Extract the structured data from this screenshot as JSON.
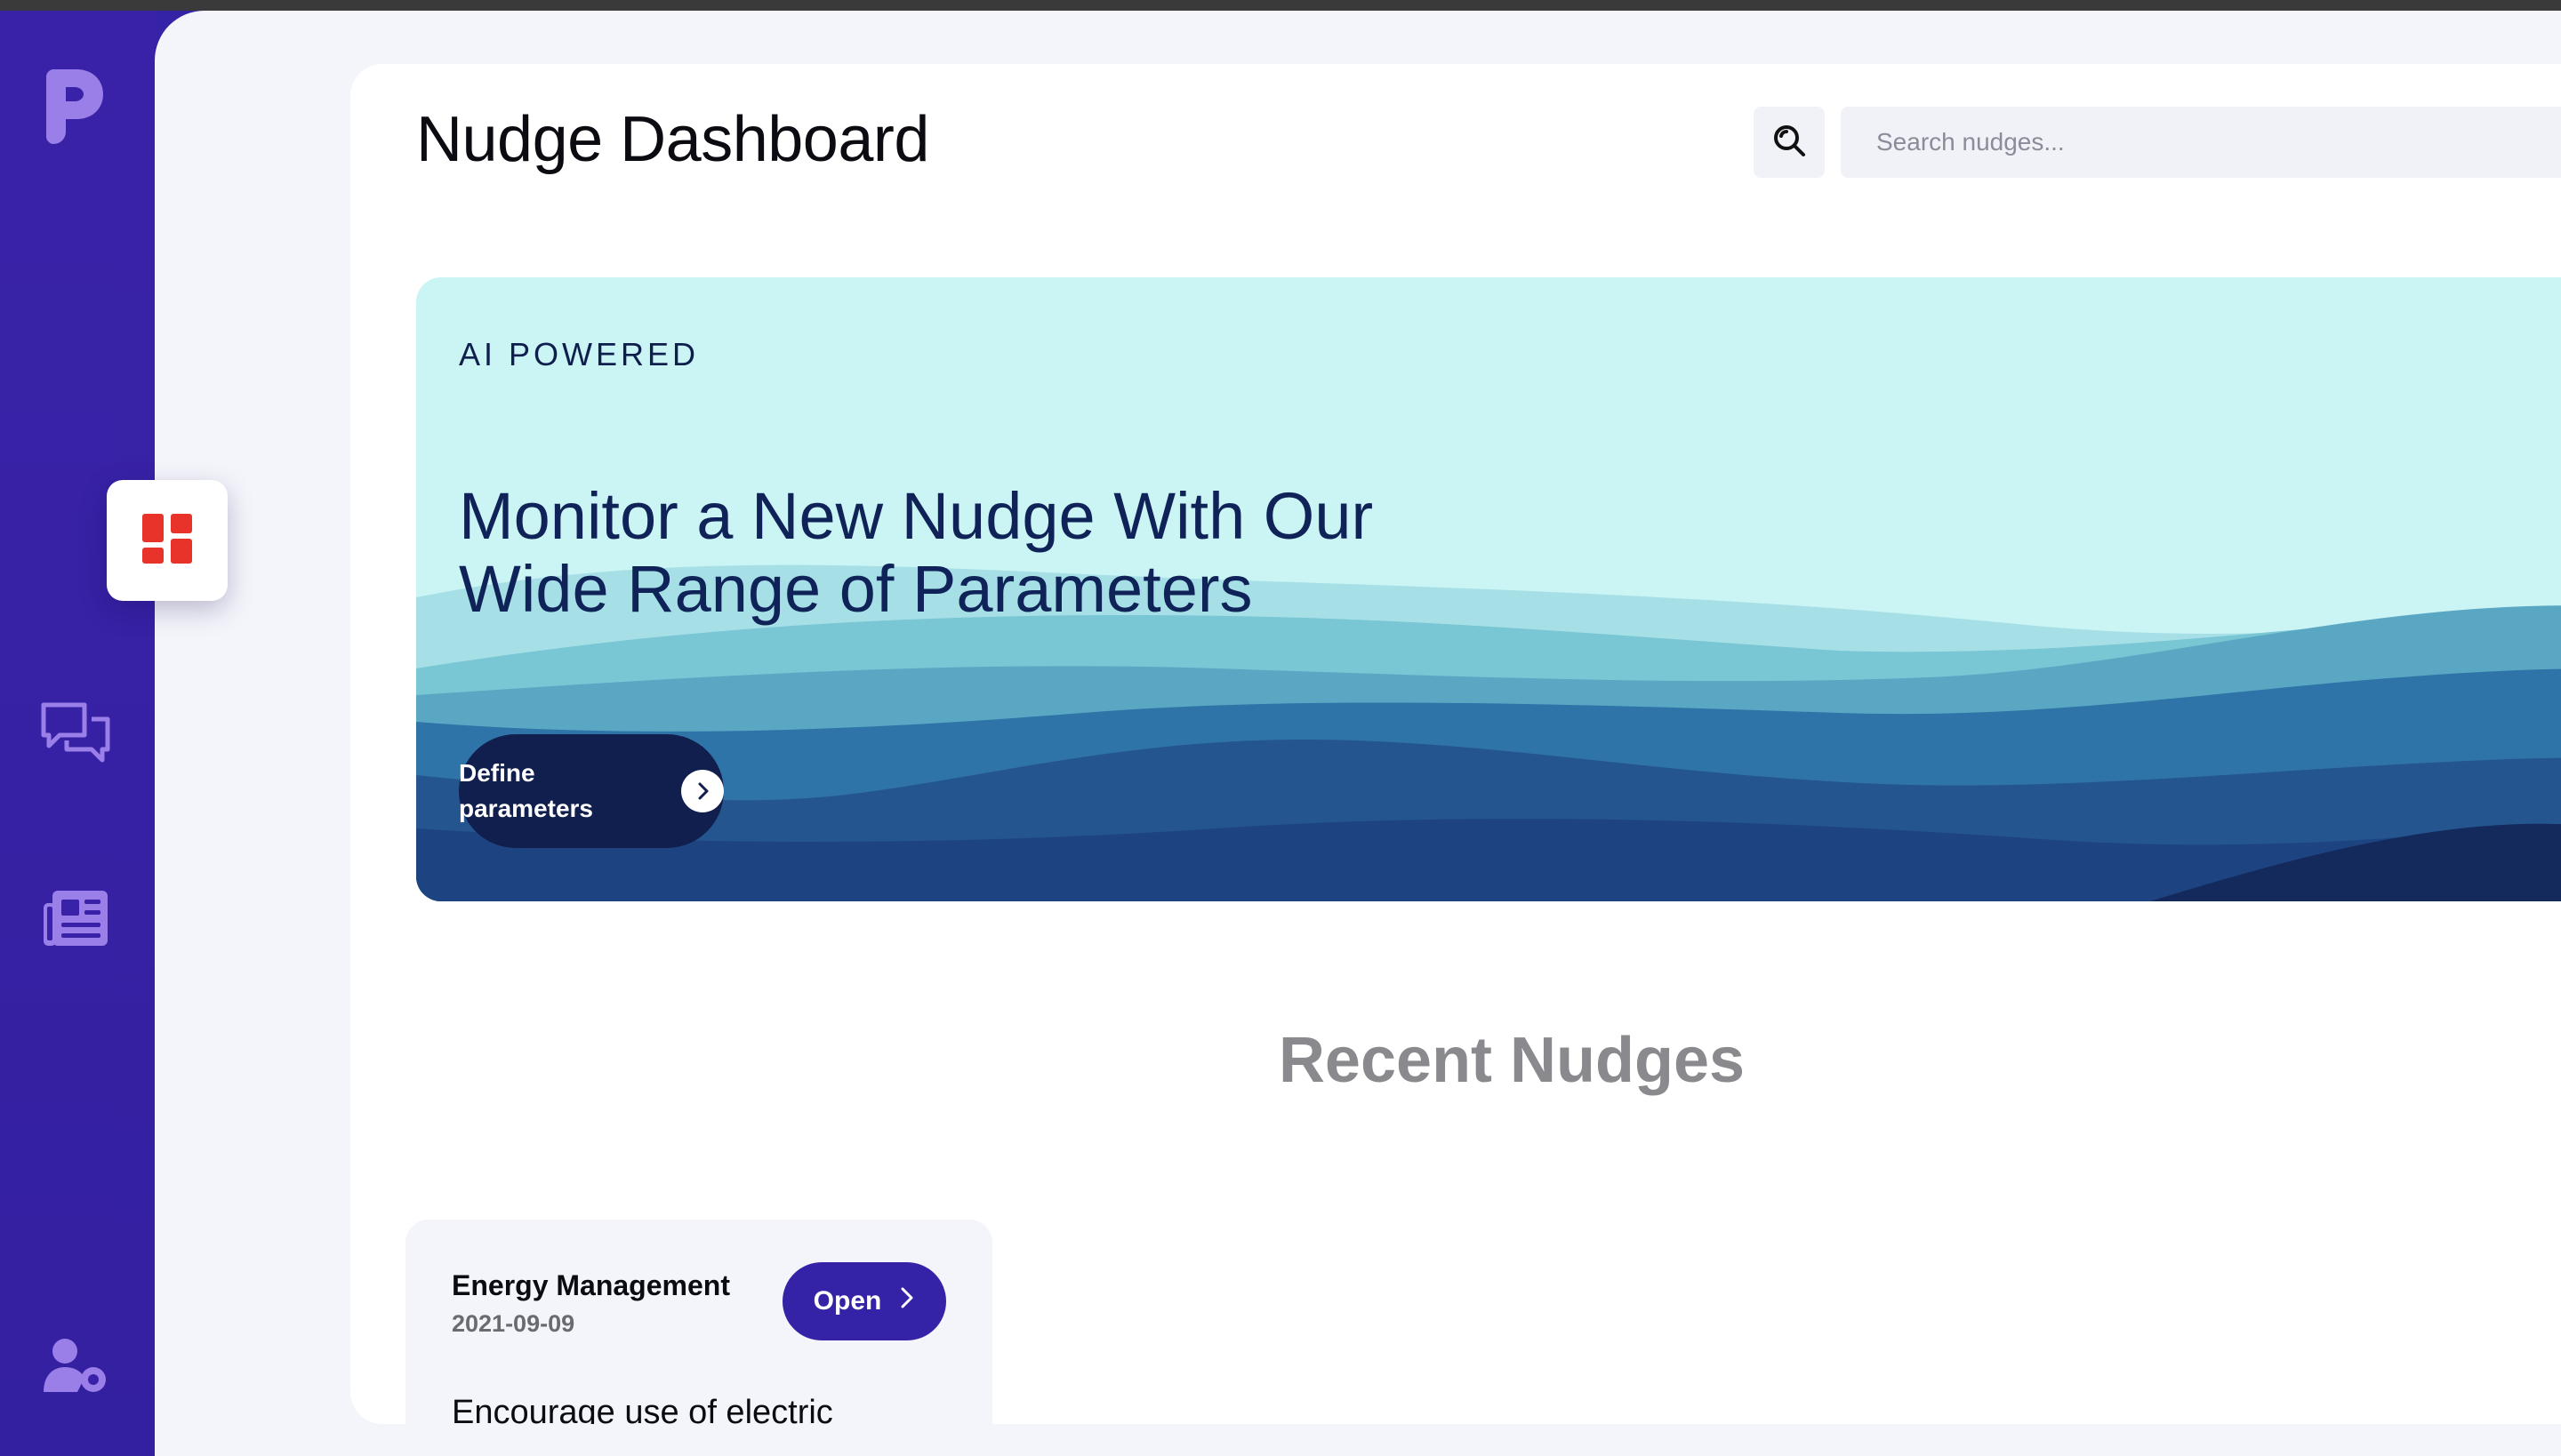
{
  "app": {
    "title": "Nudge Dashboard"
  },
  "sidebar": {
    "logo": "logo-mark",
    "items": [
      {
        "id": "dashboard",
        "icon": "dashboard-grid-icon",
        "active": true
      },
      {
        "id": "messages",
        "icon": "chat-bubbles-icon",
        "active": false
      },
      {
        "id": "news",
        "icon": "newspaper-icon",
        "active": false
      },
      {
        "id": "user-settings",
        "icon": "user-gear-icon",
        "active": false
      }
    ]
  },
  "search": {
    "icon": "search-icon",
    "placeholder": "Search nudges..."
  },
  "hero": {
    "eyebrow": "AI POWERED",
    "title": "Monitor a New Nudge With Our Wide Range of Parameters",
    "cta_label": "Define parameters",
    "cta_icon": "chevron-right-icon"
  },
  "recent": {
    "title": "Recent Nudges",
    "items": [
      {
        "title": "Energy Management",
        "date": "2021-09-09",
        "open_label": "Open",
        "description": "Encourage use of electric"
      }
    ]
  },
  "colors": {
    "sidebar": "#3423a6",
    "accent_red": "#e8332a",
    "hero_bg": "#cbf4f5",
    "hero_dark": "#111f4e",
    "open_button": "#3423a6"
  }
}
